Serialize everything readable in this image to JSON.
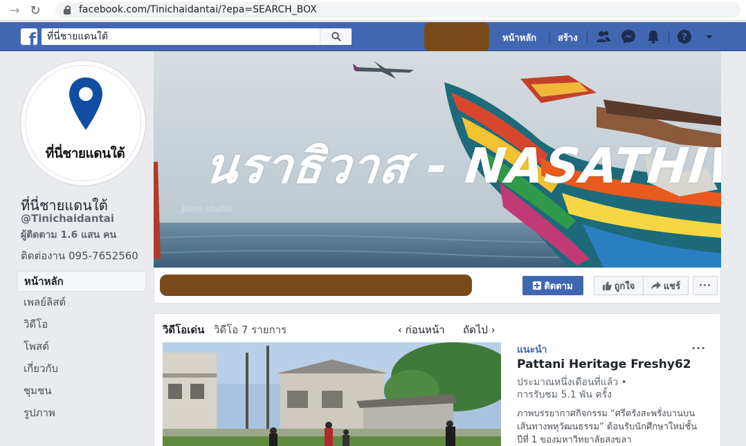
{
  "browser": {
    "url": "facebook.com/Tinichaidantai/?epa=SEARCH_BOX"
  },
  "topbar": {
    "search_value": "ที่นี่ชายแดนใต้",
    "home_label": "หน้าหลัก",
    "create_label": "สร้าง"
  },
  "profile": {
    "avatar_text": "ที่นี่ชายแดนใต้",
    "name": "ที่นี่ชายแดนใต้",
    "handle": "@Tinichaidantai",
    "followers": "ผู้ติดตาม 1.6 แสน คน",
    "contact": "ติดต่องาน 095-7652560"
  },
  "sidebar": {
    "items": [
      {
        "label": "หน้าหลัก"
      },
      {
        "label": "เพลย์ลิสต์"
      },
      {
        "label": "วิดีโอ"
      },
      {
        "label": "โพสต์"
      },
      {
        "label": "เกี่ยวกับ"
      },
      {
        "label": "ชุมชน"
      },
      {
        "label": "รูปภาพ"
      }
    ]
  },
  "cover": {
    "title": "นราธิวาส - NASATHIWAT"
  },
  "actions": {
    "follow_label": "ติดตาม",
    "like_label": "ถูกใจ",
    "share_label": "แชร์",
    "more_label": "···"
  },
  "videos": {
    "title": "วิดีโอเด่น",
    "count": "วิดีโอ 7 รายการ",
    "prev_label": "ก่อนหน้า",
    "next_label": "ถัดไป",
    "featured": {
      "tag": "แนะนำ",
      "title": "Pattani Heritage Freshy62",
      "meta_line1": "ประมาณหนึ่งเดือนที่แล้ว •",
      "meta_line2": "การรับชม 5.1 พัน ครั้ง",
      "description": "ภาพบรรยากาศกิจกรรม “ศรีตรังสะพรั่งบานบนเส้นทางพหุวัฒนธรรม” ต้อนรับนักศึกษาใหม่ชั้นปีที่ 1 ของมหาวิทยาลัยสงขลา",
      "more_label": "···"
    }
  },
  "colors": {
    "fb_blue": "#4267b2",
    "redaction": "#7b4a1a"
  }
}
